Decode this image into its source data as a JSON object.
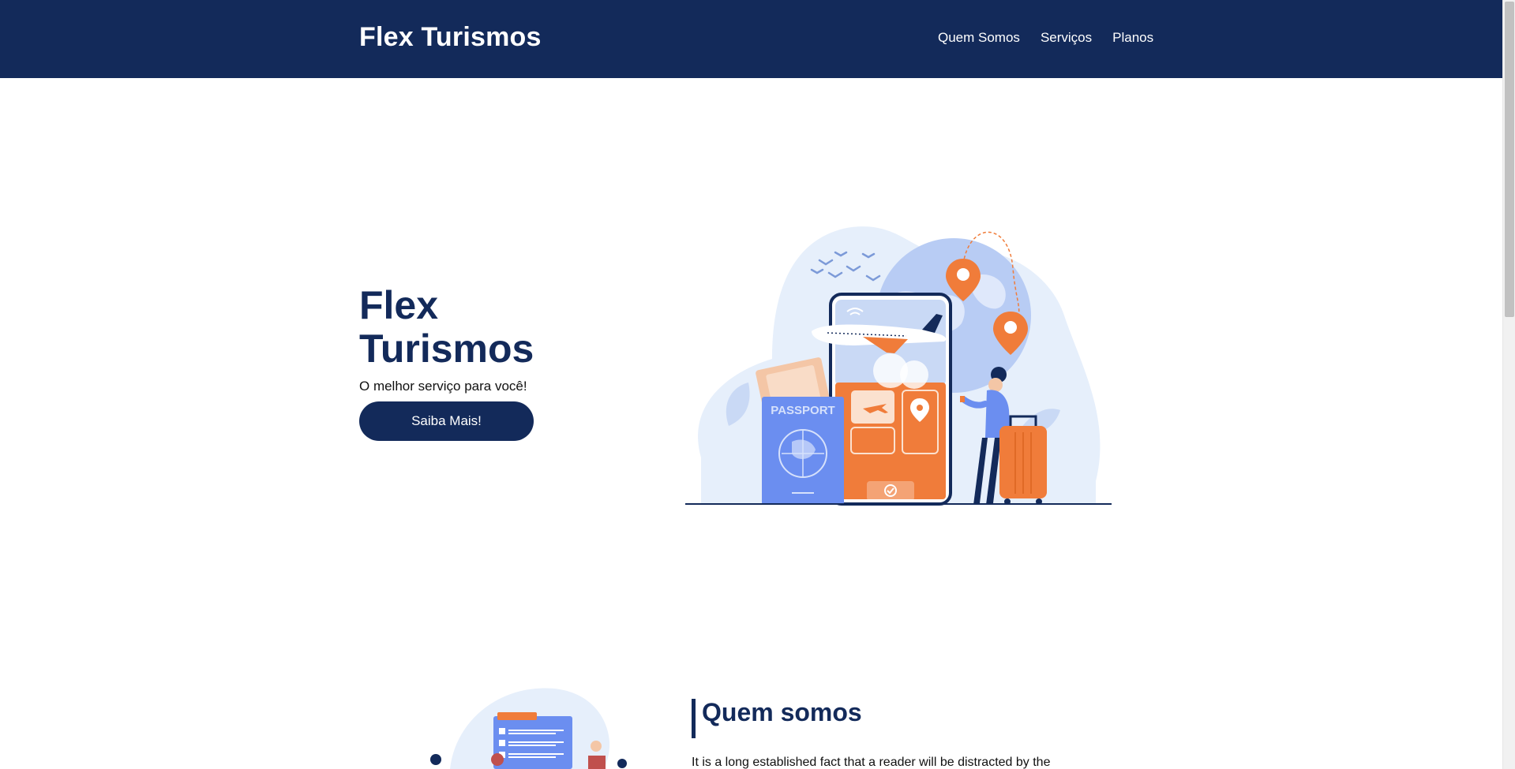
{
  "navbar": {
    "brand": "Flex Turismos",
    "links": [
      {
        "label": "Quem Somos"
      },
      {
        "label": "Serviços"
      },
      {
        "label": "Planos"
      }
    ]
  },
  "hero": {
    "title": "Flex Turismos",
    "subtitle": "O melhor serviço para você!",
    "button": "Saiba Mais!",
    "illustration": {
      "passport_label": "PASSPORT",
      "icons": [
        "airplane-icon",
        "location-pin-icon",
        "wifi-icon",
        "suitcase-icon",
        "ticket-icon",
        "globe-icon",
        "checkmark-icon"
      ]
    }
  },
  "about": {
    "title": "Quem somos",
    "text": "It is a long established fact that a reader will be distracted by the"
  },
  "colors": {
    "primary": "#132a5a",
    "accent": "#f07c3a",
    "light_blue": "#6b8ef0"
  }
}
